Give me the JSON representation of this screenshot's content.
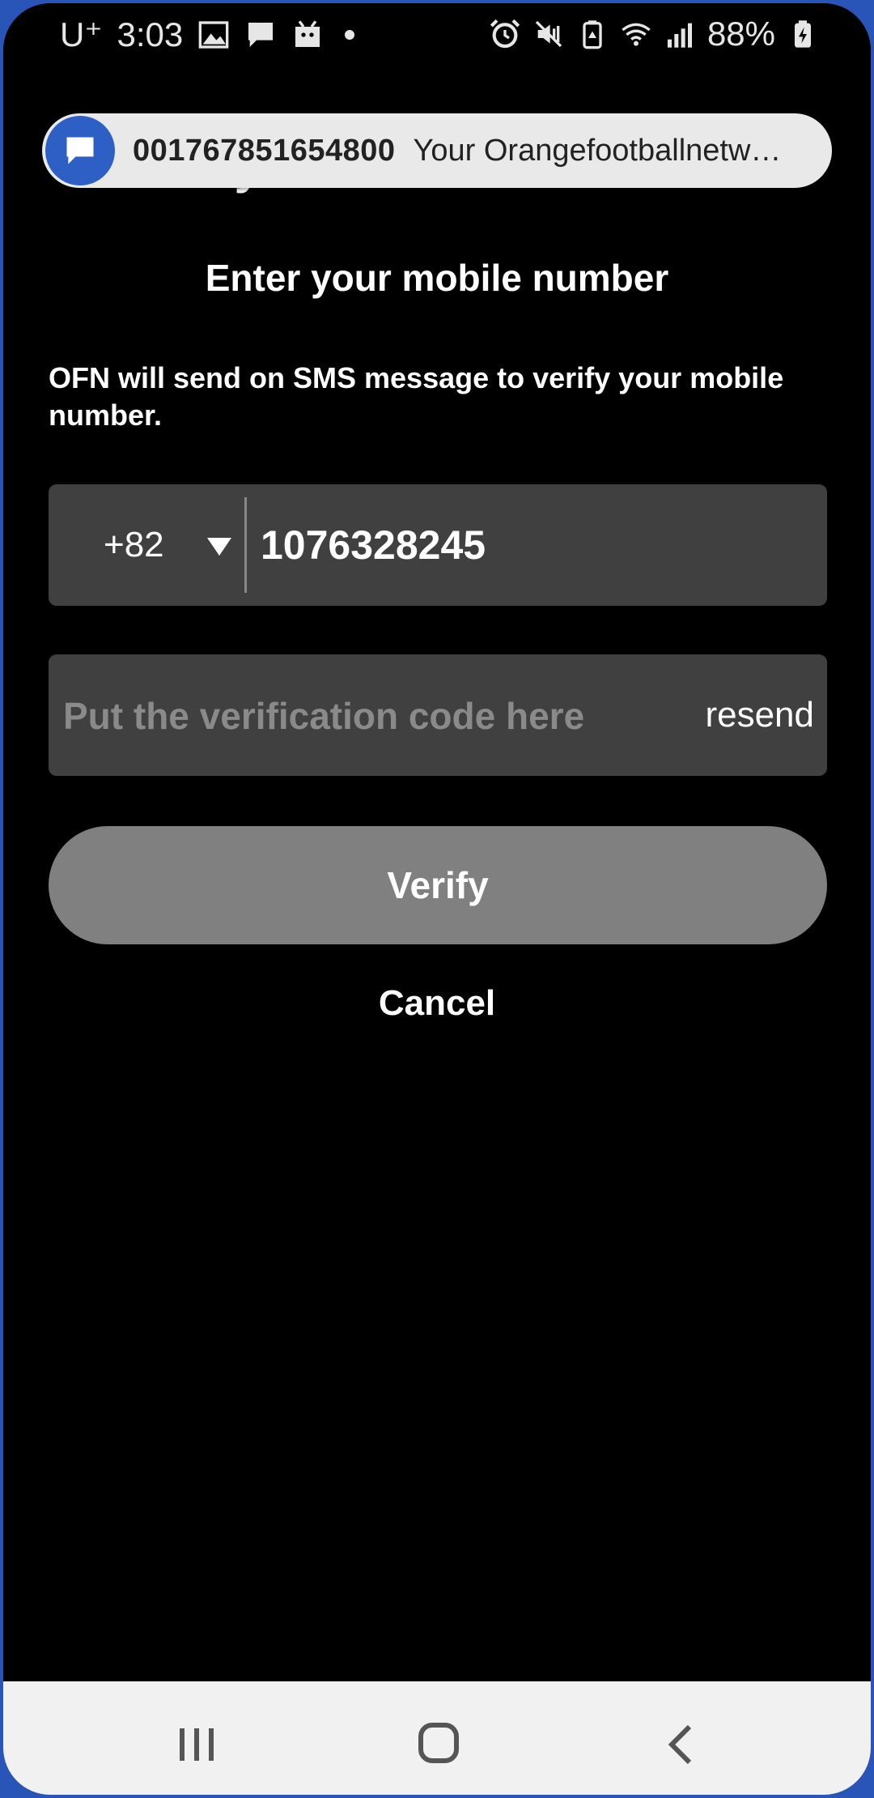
{
  "status_bar": {
    "carrier": "U⁺",
    "time": "3:03",
    "battery": "88%"
  },
  "notification": {
    "sender": "001767851654800",
    "preview": "Your Orangefootballnetwo…"
  },
  "screen": {
    "title_partial": "Verify Your Mobile Number",
    "subtitle": "Enter your mobile number",
    "description": "OFN will send on SMS message to verify your mobile number."
  },
  "phone_field": {
    "country_code": "+82",
    "number": "1076328245"
  },
  "code_field": {
    "placeholder": "Put the verification code here",
    "resend_label": "resend"
  },
  "actions": {
    "verify_label": "Verify",
    "cancel_label": "Cancel"
  },
  "colors": {
    "background": "#000000",
    "field_bg": "#404040",
    "button_bg": "#808080",
    "notification_icon": "#2e5fc4"
  },
  "icons": {
    "status_left": [
      "image-icon",
      "message-icon",
      "ar-emoji-icon"
    ],
    "status_right": [
      "alarm-icon",
      "vibrate-mute-icon",
      "battery-saver-icon",
      "wifi-icon",
      "signal-icon",
      "battery-icon"
    ],
    "nav": [
      "recents-icon",
      "home-icon",
      "back-icon"
    ]
  }
}
